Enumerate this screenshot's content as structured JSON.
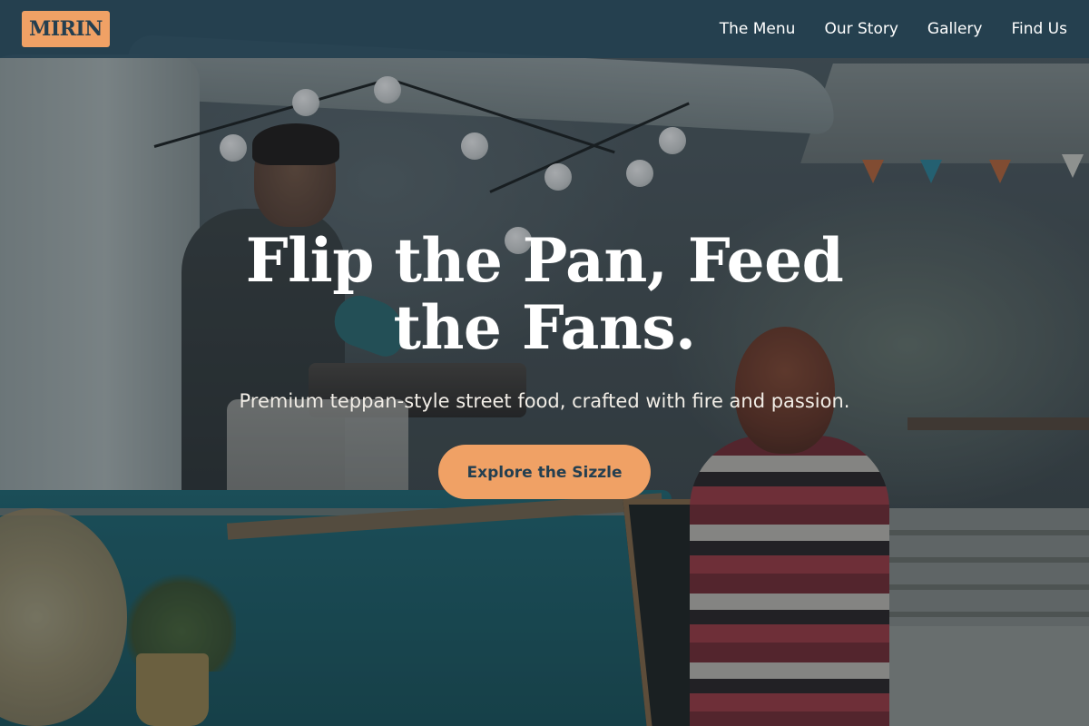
{
  "brand": {
    "name": "MIRIN"
  },
  "nav": {
    "items": [
      {
        "label": "The Menu"
      },
      {
        "label": "Our Story"
      },
      {
        "label": "Gallery"
      },
      {
        "label": "Find Us"
      }
    ]
  },
  "hero": {
    "title": "Flip the Pan, Feed the Fans.",
    "subtitle": "Premium teppan-style street food, crafted with fire and passion.",
    "cta_label": "Explore the Sizzle"
  },
  "colors": {
    "nav_background": "#244050",
    "accent": "#f0a165",
    "accent_text": "#243f50",
    "hero_text": "#ffffff"
  }
}
